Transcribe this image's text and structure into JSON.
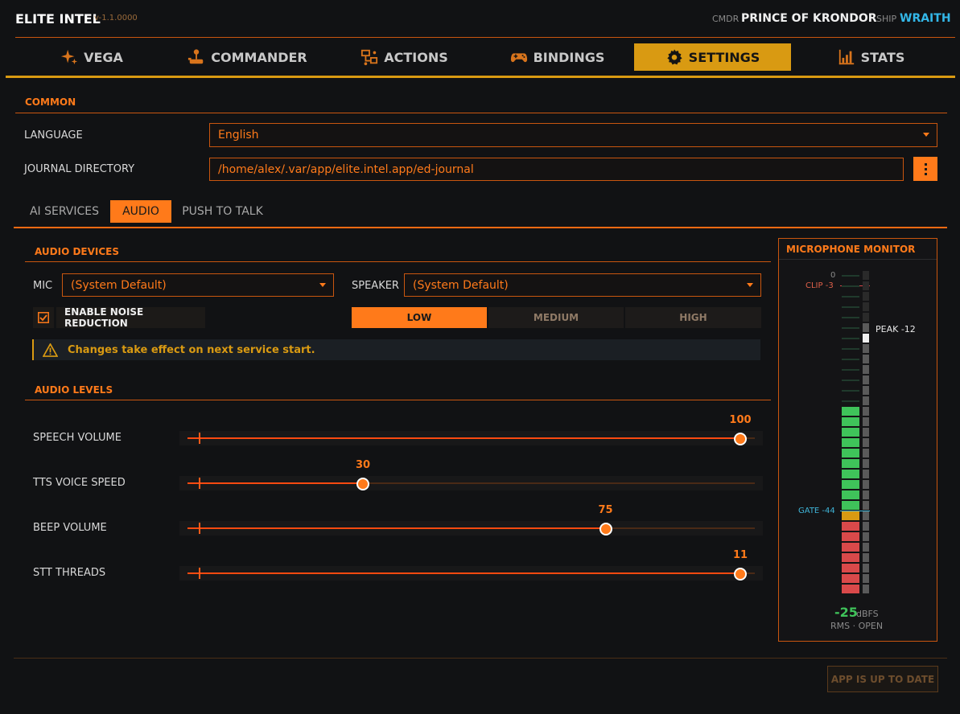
{
  "app": {
    "title": "ELITE INTEL",
    "version": "v-1.1.0000"
  },
  "header": {
    "cmdr_label": "CMDR",
    "cmdr_name": "PRINCE OF KRONDOR",
    "ship_label": "SHIP",
    "ship_name": "WRAITH"
  },
  "nav": {
    "tabs": [
      {
        "label": "VEGA",
        "icon": "sparkle-icon"
      },
      {
        "label": "COMMANDER",
        "icon": "joystick-icon"
      },
      {
        "label": "ACTIONS",
        "icon": "flowchart-icon"
      },
      {
        "label": "BINDINGS",
        "icon": "gamepad-icon"
      },
      {
        "label": "SETTINGS",
        "icon": "gear-icon",
        "active": true
      },
      {
        "label": "STATS",
        "icon": "bar-chart-icon"
      }
    ]
  },
  "common": {
    "section_title": "COMMON",
    "language_label": "LANGUAGE",
    "language_value": "English",
    "journal_label": "JOURNAL DIRECTORY",
    "journal_value": "/home/alex/.var/app/elite.intel.app/ed-journal"
  },
  "subtabs": [
    {
      "label": "AI SERVICES"
    },
    {
      "label": "AUDIO",
      "active": true
    },
    {
      "label": "PUSH TO TALK"
    }
  ],
  "audio_devices": {
    "section_title": "AUDIO DEVICES",
    "mic_label": "MIC",
    "mic_value": "(System Default)",
    "speaker_label": "SPEAKER",
    "speaker_value": "(System Default)",
    "noise_reduction_label": "ENABLE NOISE REDUCTION",
    "noise_reduction_checked": true,
    "noise_levels": [
      {
        "label": "LOW",
        "active": true
      },
      {
        "label": "MEDIUM"
      },
      {
        "label": "HIGH"
      }
    ],
    "notice": "Changes take effect on next service start."
  },
  "audio_levels": {
    "section_title": "AUDIO LEVELS",
    "sliders": [
      {
        "label": "SPEECH VOLUME",
        "value": "100",
        "fraction": 1.0
      },
      {
        "label": "TTS VOICE SPEED",
        "value": "30",
        "fraction": 0.3
      },
      {
        "label": "BEEP VOLUME",
        "value": "75",
        "fraction": 0.75
      },
      {
        "label": "STT THREADS",
        "value": "11",
        "fraction": 1.0
      }
    ]
  },
  "monitor": {
    "title": "MICROPHONE MONITOR",
    "zero_label": "0",
    "clip_label": "CLIP -3",
    "peak_label": "PEAK -12",
    "gate_label": "GATE -44",
    "rms_value": "-25",
    "rms_unit": "dBFS",
    "status": "RMS · OPEN",
    "colors": {
      "active": "#3fc35a",
      "gate": "#d99a12",
      "low": "#d9494a",
      "inactive": "#1e2a24",
      "peak": "#f0f0f0"
    }
  },
  "footer": {
    "update_label": "APP IS UP TO DATE"
  }
}
